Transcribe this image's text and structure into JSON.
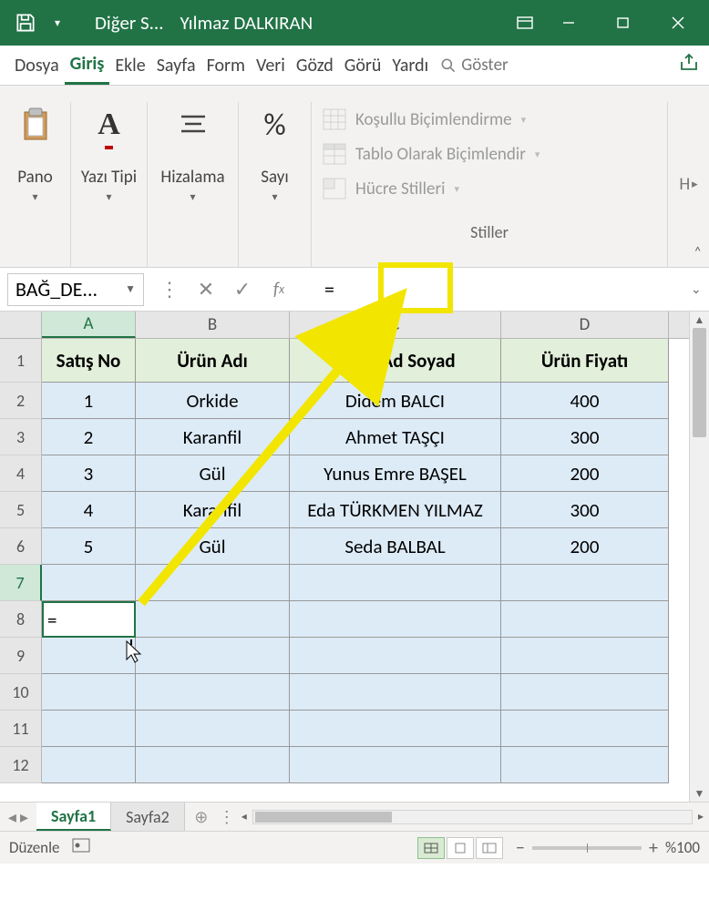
{
  "titlebar": {
    "doc_title": "Diğer S...",
    "user": "Yılmaz DALKIRAN"
  },
  "tabs": {
    "file": "Dosya",
    "home": "Giriş",
    "insert": "Ekle",
    "pagelayout": "Sayfa",
    "formulas": "Form",
    "data": "Veri",
    "review": "Gözd",
    "view": "Görü",
    "help": "Yardı",
    "tellme": "Göster"
  },
  "ribbon": {
    "clipboard": "Pano",
    "font": "Yazı Tipi",
    "alignment": "Hizalama",
    "number": "Sayı",
    "cond_format": "Koşullu Biçimlendirme",
    "table_format": "Tablo Olarak Biçimlendir",
    "cell_styles": "Hücre Stilleri",
    "styles_label": "Stiller",
    "cells_stub": "H",
    "percent": "%"
  },
  "formula_bar": {
    "namebox": "BAĞ_DE...",
    "formula": "="
  },
  "columns": {
    "A": "A",
    "B": "B",
    "C": "C",
    "D": "D"
  },
  "headers": {
    "c1": "Satış No",
    "c2": "Ürün Adı",
    "c3": "Satıcı Ad Soyad",
    "c4": "Ürün Fiyatı"
  },
  "rows": [
    {
      "no": "1",
      "urun": "Orkide",
      "satici": "Didem BALCI",
      "fiyat": "400"
    },
    {
      "no": "2",
      "urun": "Karanfil",
      "satici": "Ahmet TAŞÇI",
      "fiyat": "300"
    },
    {
      "no": "3",
      "urun": "Gül",
      "satici": "Yunus Emre BAŞEL",
      "fiyat": "200"
    },
    {
      "no": "4",
      "urun": "Karanfil",
      "satici": "Eda TÜRKMEN YILMAZ",
      "fiyat": "300"
    },
    {
      "no": "5",
      "urun": "Gül",
      "satici": "Seda BALBAL",
      "fiyat": "200"
    }
  ],
  "active_cell_value": "=",
  "row_labels": [
    "1",
    "2",
    "3",
    "4",
    "5",
    "6",
    "7",
    "8",
    "9",
    "10",
    "11",
    "12"
  ],
  "sheets": {
    "s1": "Sayfa1",
    "s2": "Sayfa2"
  },
  "status": {
    "mode": "Düzenle",
    "zoom": "%100"
  }
}
